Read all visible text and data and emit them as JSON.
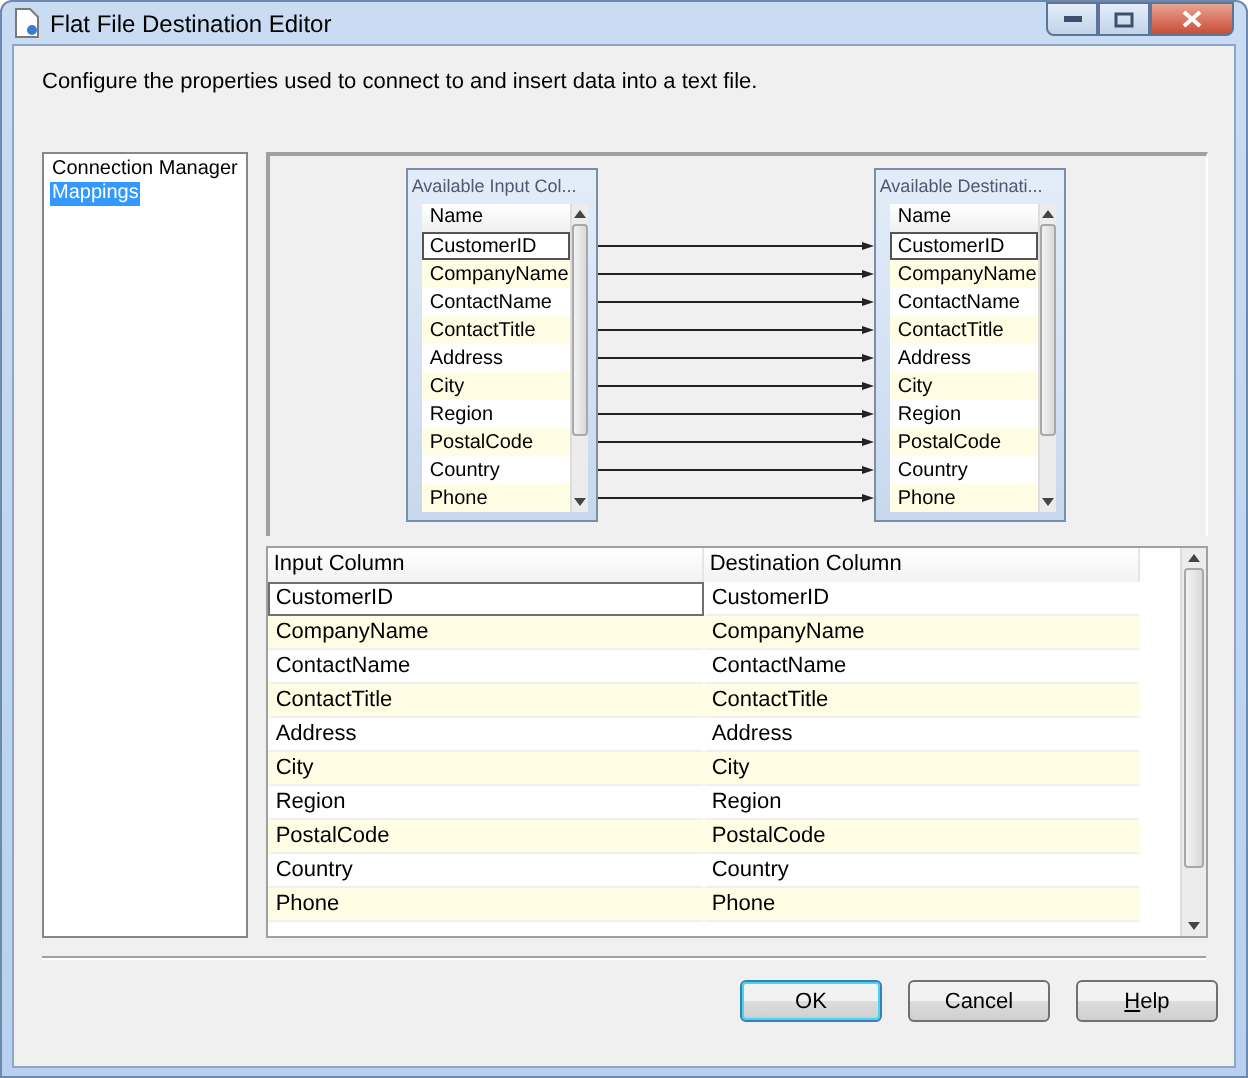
{
  "window": {
    "title": "Flat File Destination Editor"
  },
  "description": "Configure the properties used to connect to and insert data into a text file.",
  "sidebar": {
    "items": [
      {
        "label": "Connection Manager",
        "selected": false
      },
      {
        "label": "Mappings",
        "selected": true
      }
    ]
  },
  "mapping_diagram": {
    "input_list": {
      "title": "Available Input Col...",
      "header": "Name",
      "items": [
        {
          "label": "CustomerID",
          "selected": true
        },
        {
          "label": "CompanyName",
          "selected": false
        },
        {
          "label": "ContactName",
          "selected": false
        },
        {
          "label": "ContactTitle",
          "selected": false
        },
        {
          "label": "Address",
          "selected": false
        },
        {
          "label": "City",
          "selected": false
        },
        {
          "label": "Region",
          "selected": false
        },
        {
          "label": "PostalCode",
          "selected": false
        },
        {
          "label": "Country",
          "selected": false
        },
        {
          "label": "Phone",
          "selected": false
        }
      ]
    },
    "destination_list": {
      "title": "Available Destinati...",
      "header": "Name",
      "items": [
        {
          "label": "CustomerID",
          "selected": true
        },
        {
          "label": "CompanyName",
          "selected": false
        },
        {
          "label": "ContactName",
          "selected": false
        },
        {
          "label": "ContactTitle",
          "selected": false
        },
        {
          "label": "Address",
          "selected": false
        },
        {
          "label": "City",
          "selected": false
        },
        {
          "label": "Region",
          "selected": false
        },
        {
          "label": "PostalCode",
          "selected": false
        },
        {
          "label": "Country",
          "selected": false
        },
        {
          "label": "Phone",
          "selected": false
        }
      ]
    }
  },
  "mappings": {
    "columns": [
      "Input Column",
      "Destination Column"
    ],
    "rows": [
      {
        "input": "CustomerID",
        "destination": "CustomerID",
        "selected": true
      },
      {
        "input": "CompanyName",
        "destination": "CompanyName",
        "selected": false
      },
      {
        "input": "ContactName",
        "destination": "ContactName",
        "selected": false
      },
      {
        "input": "ContactTitle",
        "destination": "ContactTitle",
        "selected": false
      },
      {
        "input": "Address",
        "destination": "Address",
        "selected": false
      },
      {
        "input": "City",
        "destination": "City",
        "selected": false
      },
      {
        "input": "Region",
        "destination": "Region",
        "selected": false
      },
      {
        "input": "PostalCode",
        "destination": "PostalCode",
        "selected": false
      },
      {
        "input": "Country",
        "destination": "Country",
        "selected": false
      },
      {
        "input": "Phone",
        "destination": "Phone",
        "selected": false
      }
    ]
  },
  "buttons": [
    {
      "label": "OK",
      "default": true
    },
    {
      "label": "Cancel",
      "default": false
    },
    {
      "label": "Help",
      "default": false,
      "first_letter_underlined": true
    }
  ]
}
